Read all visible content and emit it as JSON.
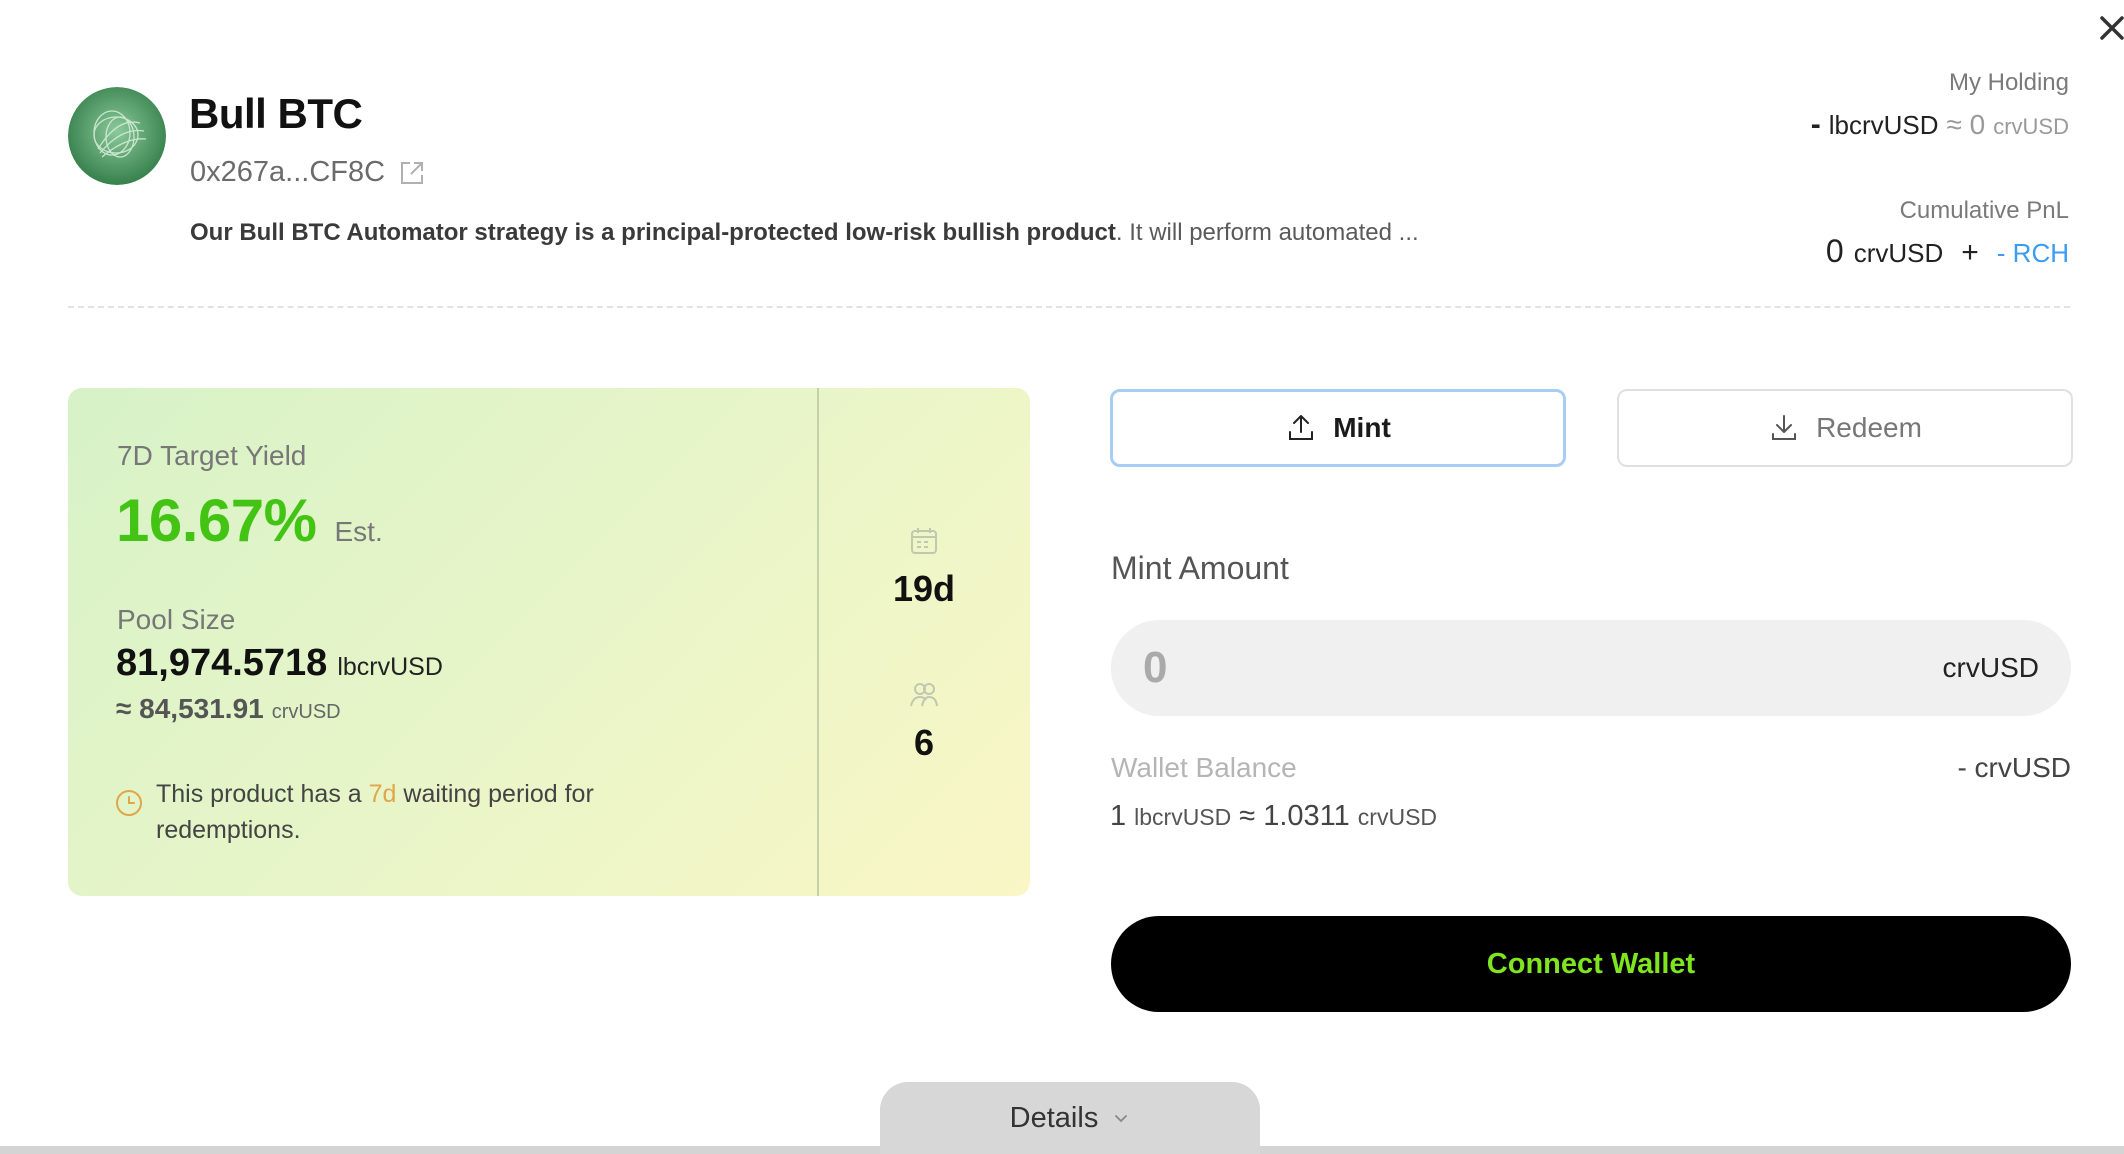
{
  "header": {
    "title": "Bull BTC",
    "address": "0x267a...CF8C",
    "description_bold": "Our Bull BTC Automator strategy is a principal-protected low-risk bullish product",
    "description_rest": ". It will perform automated ...",
    "avatar_icon": "btc-strategy-logo"
  },
  "holding": {
    "label": "My Holding",
    "dash": "-",
    "token": "lbcrvUSD",
    "approx": "≈ 0",
    "unit": "crvUSD"
  },
  "pnl": {
    "label": "Cumulative PnL",
    "value": "0",
    "unit": "crvUSD",
    "plus": "+",
    "reward": "- RCH"
  },
  "stats": {
    "yield_label": "7D Target Yield",
    "yield_value": "16.67%",
    "yield_est": "Est.",
    "pool_label": "Pool Size",
    "pool_value": "81,974.5718",
    "pool_unit": "lbcrvUSD",
    "pool_approx": "≈ 84,531.91",
    "pool_approx_unit": "crvUSD",
    "notice_prefix": "This product has a ",
    "notice_highlight": "7d",
    "notice_suffix": "  waiting period for redemptions.",
    "days_value": "19d",
    "holders_value": "6"
  },
  "tabs": {
    "mint_label": "Mint",
    "redeem_label": "Redeem"
  },
  "mint": {
    "amount_label": "Mint Amount",
    "amount_placeholder": "0",
    "amount_unit": "crvUSD",
    "wallet_label": "Wallet Balance",
    "wallet_value": "- crvUSD",
    "rate_left": "1",
    "rate_left_unit": "lbcrvUSD",
    "rate_approx": "≈ 1.0311",
    "rate_right_unit": "crvUSD",
    "connect_label": "Connect Wallet"
  },
  "footer": {
    "details_label": "Details"
  },
  "colors": {
    "accent_green": "#43c414",
    "connect_text": "#7fe51f",
    "link_blue": "#3a9cf2",
    "highlight_orange": "#e0a64a"
  }
}
